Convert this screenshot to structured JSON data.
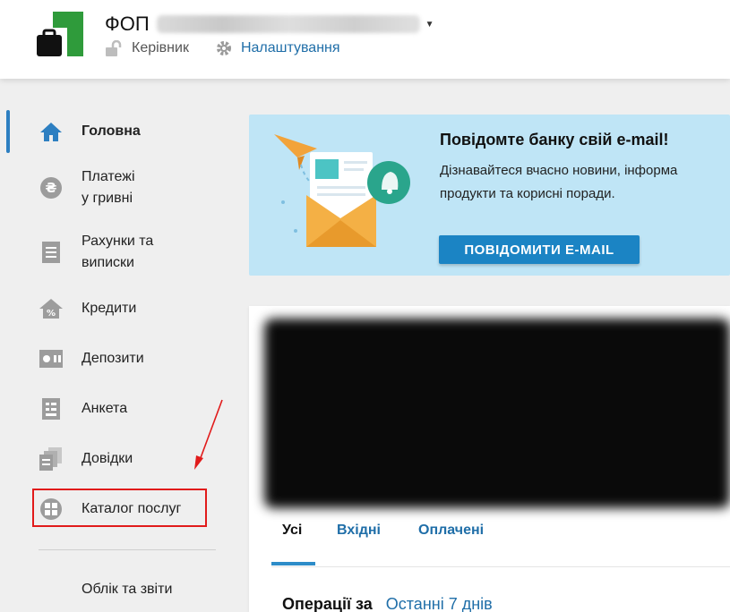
{
  "header": {
    "title_prefix": "ФОП",
    "role_label": "Керівник",
    "settings_label": "Налаштування",
    "brand_color": "#2f9b3b"
  },
  "sidebar": {
    "items": [
      {
        "label": "Головна",
        "icon": "home-icon"
      },
      {
        "label": "Платежі\nу гривні",
        "icon": "hryvnia-icon"
      },
      {
        "label": "Рахунки та\nвиписки",
        "icon": "statement-icon"
      },
      {
        "label": "Кредити",
        "icon": "credit-house-icon"
      },
      {
        "label": "Депозити",
        "icon": "deposit-icon"
      },
      {
        "label": "Анкета",
        "icon": "form-icon"
      },
      {
        "label": "Довідки",
        "icon": "documents-icon"
      },
      {
        "label": "Каталог послуг",
        "icon": "catalog-icon"
      },
      {
        "label": "Облік та звіти",
        "icon": ""
      }
    ],
    "accent_color": "#2d7fc1",
    "highlight_color": "#e11b1b"
  },
  "promo": {
    "title": "Повідомте банку свій e-mail!",
    "line1": "Дізнавайтеся вчасно новини, інформа",
    "line2": "продукти та корисні поради.",
    "button_label": "ПОВІДОМИТИ E-MAIL"
  },
  "operations": {
    "tabs": [
      "Усі",
      "Вхідні",
      "Оплачені"
    ],
    "label": "Операції за",
    "period": "Останні 7 днів"
  }
}
